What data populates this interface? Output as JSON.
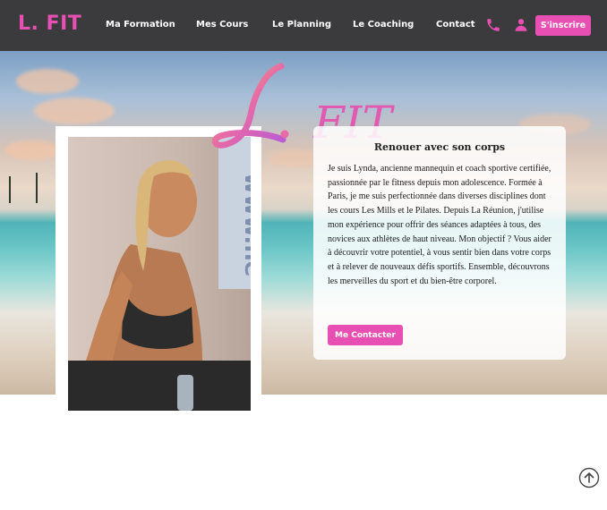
{
  "brand": {
    "logo_text": "L. FIT",
    "hero_logo_letter": "L.",
    "hero_logo_word": "FIT"
  },
  "colors": {
    "accent": "#e84fb3",
    "navbar_bg": "#3b3b3d"
  },
  "nav": {
    "items": [
      {
        "label": "Ma Formation"
      },
      {
        "label": "Mes Cours"
      },
      {
        "label": "Le Planning"
      },
      {
        "label": "Le Coaching"
      },
      {
        "label": "Contact"
      }
    ],
    "icons": [
      "phone-icon",
      "user-icon"
    ],
    "signup_label": "S'inscrire"
  },
  "hero": {
    "title": "Renouer avec son corps",
    "paragraph": "Je suis Lynda, ancienne mannequin et coach sportive certifiée, passionnée par le fitness depuis mon adolescence. Formée à Paris, je me suis perfectionnée dans diverses disciplines dont les cours Les Mills et le Pilates. Depuis La Réunion, j'utilise mon expérience pour offrir des séances adaptées à tous, des novices aux athlètes de haut niveau. Mon objectif ? Vous aider à découvrir votre potentiel, à vous sentir bien dans votre corps et à relever de nouveaux défis sportifs. Ensemble, découvrons les merveilles du sport et du bien-être corporel.",
    "cta_label": "Me Contacter",
    "photo_subject": "coach-portrait",
    "photo_backdrop_text": "www.ne"
  },
  "footer": {
    "scroll_top_icon": "arrow-up-circle-icon"
  }
}
